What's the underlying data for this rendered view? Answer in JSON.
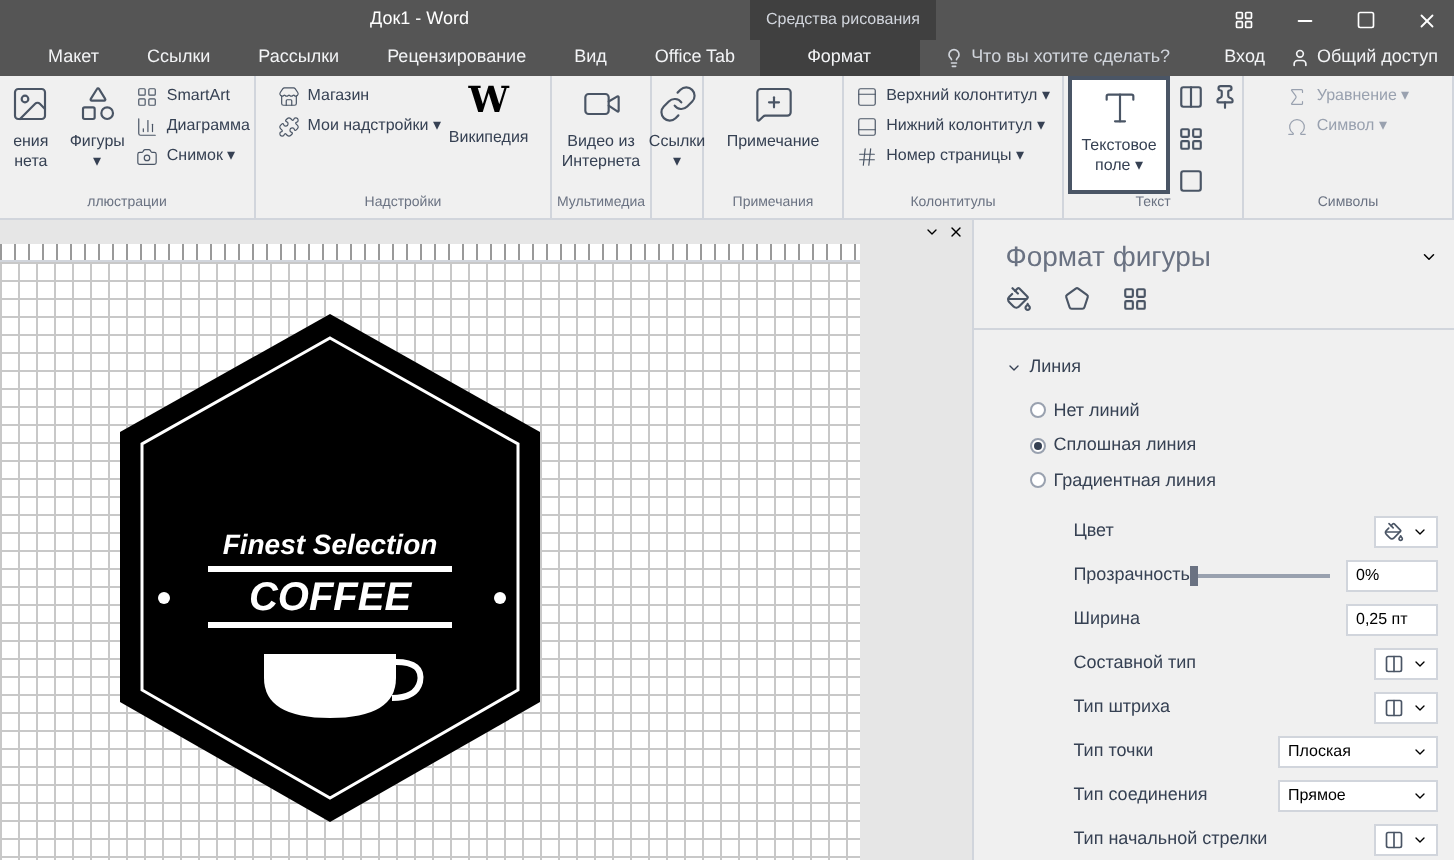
{
  "window": {
    "title": "Док1 - Word",
    "contextual_group": "Средства рисования"
  },
  "tabs": [
    {
      "label": "Макет",
      "selected": false
    },
    {
      "label": "Ссылки",
      "selected": false
    },
    {
      "label": "Рассылки",
      "selected": false
    },
    {
      "label": "Рецензирование",
      "selected": false
    },
    {
      "label": "Вид",
      "selected": false
    },
    {
      "label": "Office Tab",
      "selected": false
    },
    {
      "label": "Формат",
      "selected": false,
      "kind": "contextual"
    }
  ],
  "search": {
    "placeholder": "Что вы хотите сделать?"
  },
  "account": {
    "sign_in": "Вход",
    "share": "Общий доступ"
  },
  "ribbon": [
    {
      "label": "ллюстрации",
      "items": [
        {
          "kind": "large",
          "label": "ения нета"
        },
        {
          "kind": "large",
          "label": "Фигуры ▾"
        },
        {
          "kind": "stack",
          "items": [
            {
              "label": "SmartArt"
            },
            {
              "label": "Диаграмма"
            },
            {
              "label": "Снимок ▾"
            }
          ]
        }
      ]
    },
    {
      "label": "Надстройки",
      "items": [
        {
          "kind": "stack",
          "items": [
            {
              "label": "Магазин"
            },
            {
              "label": "Мои надстройки ▾"
            }
          ]
        },
        {
          "kind": "glyph",
          "glyph": "W",
          "label": "Википедия"
        }
      ]
    },
    {
      "label": "Мультимедиа",
      "items": [
        {
          "kind": "large",
          "label": "Видео из Интернета"
        }
      ]
    },
    {
      "items": [
        {
          "kind": "large",
          "label": "Ссылки ▾"
        }
      ]
    },
    {
      "label": "Примечания",
      "items": [
        {
          "kind": "large",
          "label": "Примечание"
        }
      ]
    },
    {
      "label": "Колонтитулы",
      "items": [
        {
          "kind": "stack",
          "items": [
            {
              "label": "Верхний колонтитул ▾"
            },
            {
              "label": "Нижний колонтитул ▾"
            },
            {
              "label": "Номер страницы ▾"
            }
          ]
        }
      ]
    },
    {
      "label": "Текст",
      "items": [
        {
          "kind": "large",
          "label": "Текстовое поле ▾",
          "highlighted": true
        },
        {
          "kind": "icons"
        }
      ]
    },
    {
      "label": "Символы",
      "items": [
        {
          "kind": "stack",
          "disabled": true,
          "items": [
            {
              "label": "Уравнение ▾"
            },
            {
              "label": "Символ ▾"
            }
          ]
        }
      ]
    }
  ],
  "logo": {
    "line1": "Finest Selection",
    "line2": "COFFEE"
  },
  "panel": {
    "title": "Формат фигуры",
    "section": {
      "label": "Линия",
      "expanded": true,
      "options": [
        {
          "label": "Нет линий",
          "selected": false
        },
        {
          "label": "Сплошная линия",
          "selected": true
        },
        {
          "label": "Градиентная линия",
          "selected": false
        }
      ],
      "properties": [
        {
          "kind": "color",
          "label": "Цвет"
        },
        {
          "kind": "slider",
          "label": "Прозрачность",
          "level": 0,
          "value": "0%"
        },
        {
          "kind": "spin",
          "label": "Ширина",
          "value": "0,25 пт"
        },
        {
          "kind": "icon",
          "label": "Составной тип"
        },
        {
          "kind": "icon",
          "label": "Тип штриха"
        },
        {
          "kind": "dropdown",
          "label": "Тип точки",
          "value": "Плоская"
        },
        {
          "kind": "dropdown",
          "label": "Тип соединения",
          "value": "Прямое"
        },
        {
          "kind": "icon",
          "label": "Тип начальной стрелки"
        }
      ]
    }
  }
}
